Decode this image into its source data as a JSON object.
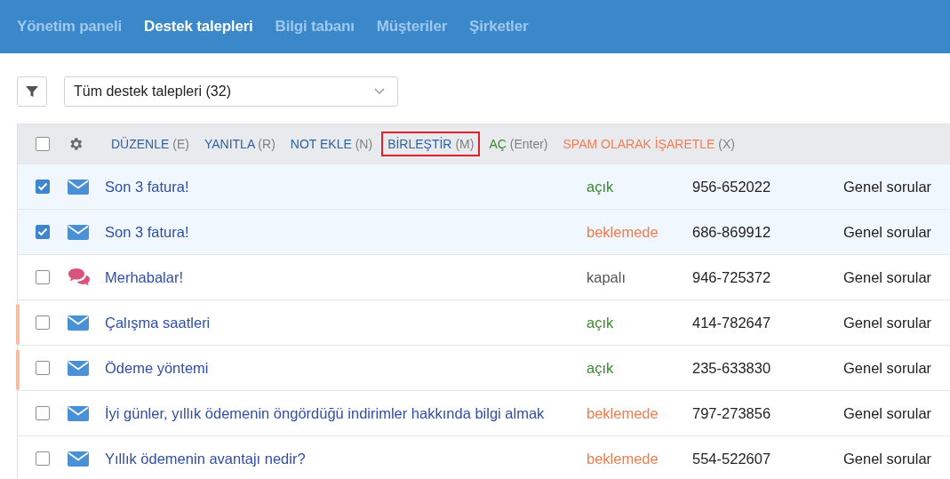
{
  "nav": {
    "tabs": [
      {
        "label": "Yönetim paneli",
        "selected": false
      },
      {
        "label": "Destek talepleri",
        "selected": true
      },
      {
        "label": "Bilgi tabanı",
        "selected": false
      },
      {
        "label": "Müşteriler",
        "selected": false
      },
      {
        "label": "Şirketler",
        "selected": false
      }
    ]
  },
  "filter": {
    "view_select": {
      "value": "Tüm destek talepleri (32)"
    }
  },
  "toolbar": {
    "select_all": {
      "checked": false
    },
    "actions": [
      {
        "label": "DÜZENLE",
        "shortcut": "(E)",
        "kind": "normal",
        "highlighted": false
      },
      {
        "label": "YANITLA",
        "shortcut": "(R)",
        "kind": "normal",
        "highlighted": false
      },
      {
        "label": "NOT EKLE",
        "shortcut": "(N)",
        "kind": "normal",
        "highlighted": false
      },
      {
        "label": "BİRLEŞTİR",
        "shortcut": "(M)",
        "kind": "normal",
        "highlighted": true
      },
      {
        "label": "AÇ",
        "shortcut": "(Enter)",
        "kind": "positive",
        "highlighted": false
      },
      {
        "label": "SPAM OLARAK İŞARETLE",
        "shortcut": "(X)",
        "kind": "warning",
        "highlighted": false
      }
    ]
  },
  "tickets": [
    {
      "checked": true,
      "flagged": false,
      "kind": "email",
      "subject": "Son 3 fatura!",
      "status": {
        "text": "açık",
        "kind": "open"
      },
      "phone": "956-652022",
      "category": "Genel sorular"
    },
    {
      "checked": true,
      "flagged": false,
      "kind": "email",
      "subject": "Son 3 fatura!",
      "status": {
        "text": "beklemede",
        "kind": "pending"
      },
      "phone": "686-869912",
      "category": "Genel sorular"
    },
    {
      "checked": false,
      "flagged": false,
      "kind": "chat",
      "subject": "Merhabalar!",
      "status": {
        "text": "kapalı",
        "kind": "closed"
      },
      "phone": "946-725372",
      "category": "Genel sorular"
    },
    {
      "checked": false,
      "flagged": true,
      "kind": "email",
      "subject": "Çalışma saatleri",
      "status": {
        "text": "açık",
        "kind": "open"
      },
      "phone": "414-782647",
      "category": "Genel sorular"
    },
    {
      "checked": false,
      "flagged": true,
      "kind": "email",
      "subject": "Ödeme yöntemi",
      "status": {
        "text": "açık",
        "kind": "open"
      },
      "phone": "235-633830",
      "category": "Genel sorular"
    },
    {
      "checked": false,
      "flagged": false,
      "kind": "email",
      "subject": "İyi günler, yıllık ödemenin öngördüğü indirimler hakkında bilgi almak",
      "status": {
        "text": "beklemede",
        "kind": "pending"
      },
      "phone": "797-273856",
      "category": "Genel sorular"
    },
    {
      "checked": false,
      "flagged": false,
      "kind": "email",
      "subject": "Yıllık ödemenin avantajı nedir?",
      "status": {
        "text": "beklemede",
        "kind": "pending"
      },
      "phone": "554-522607",
      "category": "Genel sorular"
    }
  ]
}
